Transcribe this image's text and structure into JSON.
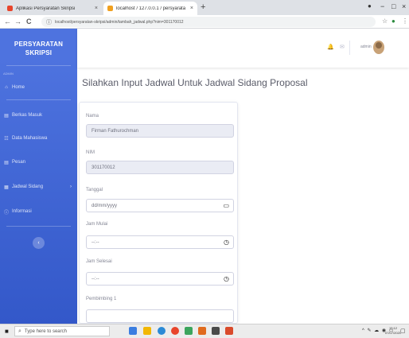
{
  "browser": {
    "tabs": [
      {
        "title": "Aplikasi Persyaratan Skripsi",
        "close": "×"
      },
      {
        "title": "localhost / 127.0.0.1 / persyarata",
        "close": "×"
      }
    ],
    "new_tab": "+",
    "window_controls": {
      "minimize": "−",
      "maximize": "□",
      "close": "×"
    },
    "url": "localhost/persyaratan-skripsi/admin/tambah_jadwal.php?nim=301170012",
    "icons": {
      "back": "←",
      "forward": "→",
      "reload": "C",
      "info": "ⓘ",
      "star": "☆",
      "menu": "⋮"
    }
  },
  "sidebar": {
    "brand_line1": "PERSYARATAN",
    "brand_line2": "SKRIPSI",
    "heading": "ADMIN",
    "items": [
      {
        "icon": "⌂",
        "label": "Home"
      },
      {
        "icon": "▤",
        "label": "Berkas Masuk"
      },
      {
        "icon": "☷",
        "label": "Data Mahasiswa"
      },
      {
        "icon": "▤",
        "label": "Pesan"
      },
      {
        "icon": "▦",
        "label": "Jadwal Sidang",
        "chevron": "›"
      },
      {
        "icon": "ⓘ",
        "label": "Informasi"
      }
    ],
    "toggle": "‹"
  },
  "topbar": {
    "icon_bell": "🔔",
    "icon_mail": "✉",
    "username": "admin"
  },
  "main": {
    "title": "Silahkan Input Jadwal Untuk Jadwal Sidang Proposal",
    "form": {
      "nama_label": "Nama",
      "nama_value": "Firman Fathurochman",
      "nim_label": "NIM",
      "nim_value": "301170012",
      "tanggal_label": "Tanggal",
      "tanggal_placeholder": "dd/mm/yyyy",
      "tanggal_icon": "▭",
      "jam_mulai_label": "Jam Mulai",
      "jam_mulai_placeholder": "--:--",
      "jam_selesai_label": "Jam Selesai",
      "jam_selesai_placeholder": "--:--",
      "clock_icon": "◷",
      "pembimbing_label": "Pembimbing 1"
    }
  },
  "taskbar": {
    "start": "■",
    "search_placeholder": "Type here to search",
    "tray": "^ ✎ ☁ ◉ ▭",
    "time": "15:12",
    "date": "07/07/2021",
    "notification": "▢",
    "app_colors": [
      "#3b7de0",
      "#f2b705",
      "#2b8ad6",
      "#e8452c",
      "#3ba55d",
      "#e06b1f",
      "#4a4a4a",
      "#d94a2b"
    ]
  },
  "colors": {
    "primary": "#4e73df",
    "tab_active": "#ffffff",
    "tab_favicon_1": "#e8452c",
    "tab_favicon_2": "#f0a020"
  }
}
